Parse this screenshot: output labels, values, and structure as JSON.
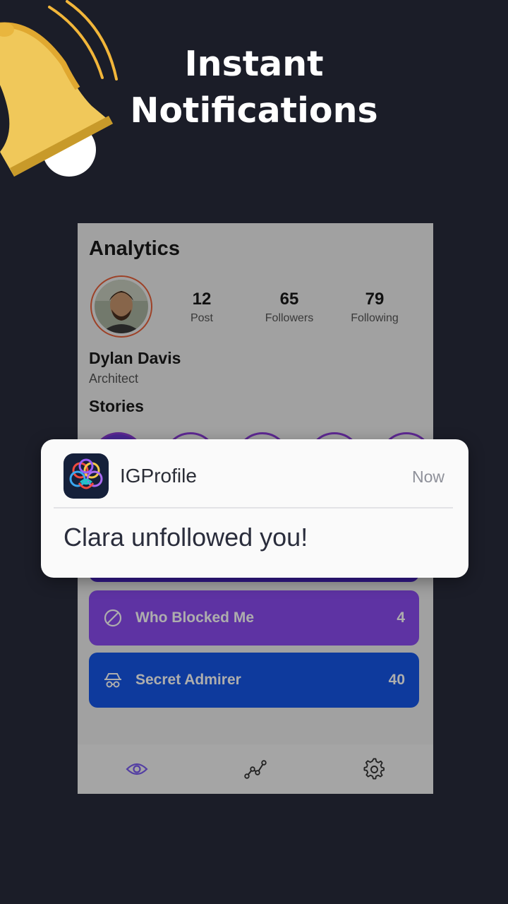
{
  "promo": {
    "line1": "Instant",
    "line2": "Notifications"
  },
  "app": {
    "screen_title": "Analytics",
    "profile": {
      "name": "Dylan Davis",
      "role": "Architect",
      "stats": [
        {
          "value": "12",
          "label": "Post"
        },
        {
          "value": "65",
          "label": "Followers"
        },
        {
          "value": "79",
          "label": "Following"
        }
      ]
    },
    "stories_title": "Stories",
    "cards": {
      "blocked": {
        "label": "Who Blocked Me",
        "value": "4",
        "icon": "blocked-icon",
        "color": "#8b4cf0"
      },
      "admirer": {
        "label": "Secret Admirer",
        "value": "40",
        "icon": "spy-icon",
        "color": "#1656e8"
      }
    },
    "nav": [
      "eye-icon",
      "analytics-icon",
      "gear-icon"
    ]
  },
  "notification": {
    "app_name": "IGProfile",
    "time": "Now",
    "message": "Clara unfollowed you!"
  },
  "colors": {
    "background": "#1b1d28",
    "bell": "#f2c94c",
    "accent": "#8a3bd6"
  }
}
